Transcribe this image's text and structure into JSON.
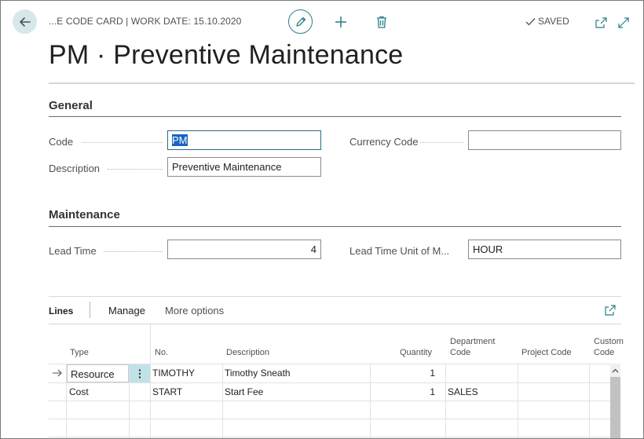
{
  "header": {
    "breadcrumb": "...E CODE CARD | WORK DATE: 15.10.2020",
    "saved_label": "SAVED",
    "title": "PM · Preventive Maintenance"
  },
  "general": {
    "section_title": "General",
    "code_label": "Code",
    "code_value": "PM",
    "description_label": "Description",
    "description_value": "Preventive Maintenance",
    "currency_label": "Currency Code",
    "currency_value": ""
  },
  "maintenance": {
    "section_title": "Maintenance",
    "lead_time_label": "Lead Time",
    "lead_time_value": "4",
    "lead_time_unit_label": "Lead Time Unit of M...",
    "lead_time_unit_value": "HOUR"
  },
  "lines": {
    "tabs": [
      "Lines",
      "Manage",
      "More options"
    ],
    "columns": {
      "type": "Type",
      "no": "No.",
      "description": "Description",
      "quantity": "Quantity",
      "department_1": "Department",
      "department_2": "Code",
      "project": "Project Code",
      "customer_1": "Custom",
      "customer_2": "Code"
    },
    "rows": [
      {
        "type": "Resource",
        "no": "TIMOTHY",
        "description": "Timothy Sneath",
        "quantity": "1",
        "department": ""
      },
      {
        "type": "Cost",
        "no": "START",
        "description": "Start Fee",
        "quantity": "1",
        "department": "SALES"
      }
    ]
  },
  "colors": {
    "accent": "#2a7f87",
    "back_button_bg": "#d6e8ec",
    "selection": "#1a64c0",
    "active_row_marker": "#bfe3e8"
  }
}
